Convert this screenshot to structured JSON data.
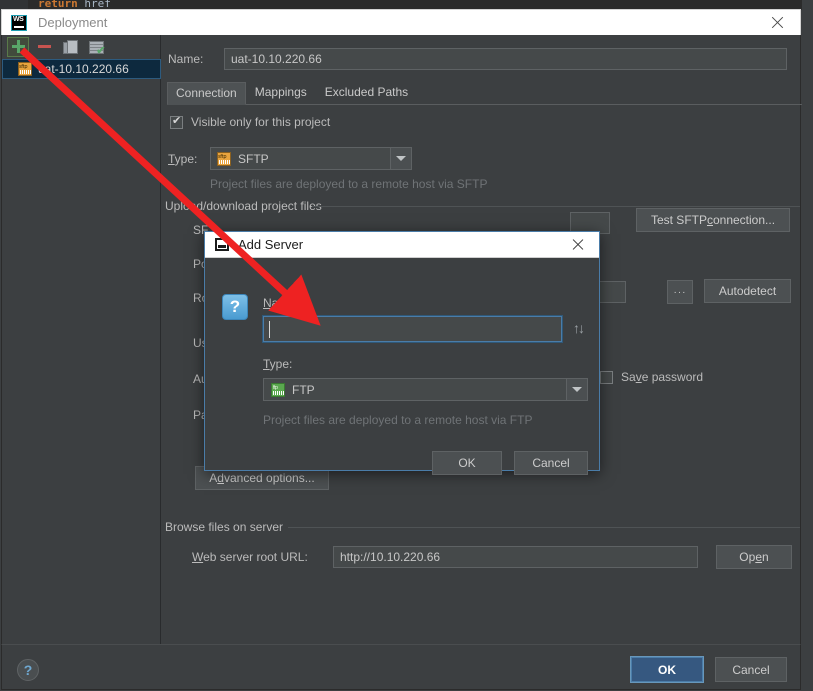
{
  "editor_background": {
    "code_keyword": "return",
    "code_identifier": "href"
  },
  "window": {
    "title": "Deployment",
    "app_icon": "webstorm-logo-icon",
    "close_icon": "close-icon"
  },
  "left_panel": {
    "toolbar": [
      {
        "name": "add-server-button",
        "icon": "plus-icon",
        "label": "+"
      },
      {
        "name": "remove-server-button",
        "icon": "minus-icon",
        "label": "−"
      },
      {
        "name": "copy-server-button",
        "icon": "copy-icon",
        "label": "Copy"
      },
      {
        "name": "set-default-server-button",
        "icon": "set-default-icon",
        "label": "Use as default"
      }
    ],
    "servers": [
      {
        "label": "uat-10.10.220.66",
        "icon": "sftp-icon",
        "selected": true
      }
    ]
  },
  "main": {
    "name_label": "Name:",
    "name_value": "uat-10.10.220.66",
    "tabs": [
      {
        "label": "Connection",
        "active": true
      },
      {
        "label": "Mappings",
        "active": false
      },
      {
        "label": "Excluded Paths",
        "active": false
      }
    ],
    "visible_only_checkbox": {
      "label": "Visible only for this project",
      "checked": true
    },
    "type_label": "Type:",
    "type_value": "SFTP",
    "type_icon": "sftp-icon",
    "type_hint": "Project files are deployed to a remote host via SFTP",
    "upload_group_label": "Upload/download project files",
    "fields": [
      {
        "label": "SF",
        "full": "SFTP host:"
      },
      {
        "label": "Po",
        "full": "Port:"
      },
      {
        "label": "Ro",
        "full": "Root path:"
      },
      {
        "label": "Us",
        "full": "User name:"
      },
      {
        "label": "Au",
        "full": "Auth type:"
      },
      {
        "label": "Pa",
        "full": "Password:"
      }
    ],
    "test_connection_button": "Test SFTP connection...",
    "browse_button": "...",
    "autodetect_button": "Autodetect",
    "save_password_checkbox": {
      "label": "Save password",
      "checked": false
    },
    "advanced_options_button": "Advanced options...",
    "browse_group_label": "Browse files on server",
    "web_root_label": "Web server root URL:",
    "web_root_value": "http://10.10.220.66",
    "open_button": "Open"
  },
  "modal": {
    "title": "Add Server",
    "title_icon": "server-icon",
    "close_icon": "close-icon",
    "help_icon": "question-mark-icon",
    "name_label": "Name:",
    "name_value": "",
    "name_placeholder": "",
    "history_icon": "up-down-arrows-icon",
    "type_label": "Type:",
    "type_value": "FTP",
    "type_icon": "ftp-icon",
    "type_hint": "Project files are deployed to a remote host via FTP",
    "ok_button": "OK",
    "cancel_button": "Cancel"
  },
  "footer": {
    "help_button": "?",
    "ok_button": "OK",
    "cancel_button": "Cancel"
  },
  "annotation": {
    "arrow_color": "#ee2222",
    "from": "add-server-button",
    "to": "modal-name-input"
  },
  "colors": {
    "window_background": "#3c3f41",
    "editor_background": "#2b2b2b",
    "selection_blue": "#0d293e",
    "accent_blue": "#4a7ca8",
    "primary_button": "#365880",
    "green_icon": "#59a869",
    "red_icon": "#c75450",
    "sftp_orange": "#e8a33d"
  }
}
